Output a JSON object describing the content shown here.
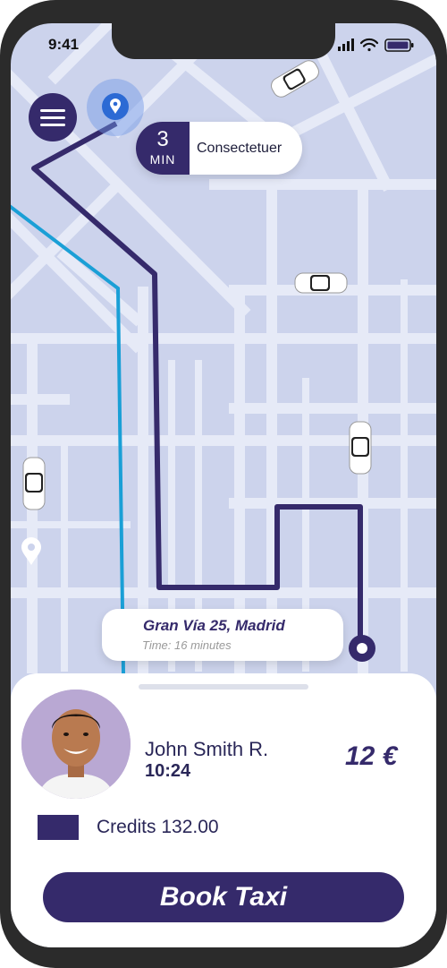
{
  "status_bar": {
    "time": "9:41"
  },
  "eta": {
    "minutes": "3",
    "unit": "MIN",
    "label": "Consectetuer"
  },
  "destination": {
    "address": "Gran Vía 25, Madrid",
    "time": "Time: 16 minutes"
  },
  "driver": {
    "name": "John Smith R.",
    "pickup_time": "10:24",
    "price": "12 €"
  },
  "credits": {
    "label": "Credits 132.00"
  },
  "actions": {
    "book_label": "Book Taxi"
  },
  "colors": {
    "primary": "#352a6b",
    "map_bg": "#ccd3ec",
    "map_road": "#e6eaf7",
    "transit_line": "#1a9fd6",
    "location_pin": "#2c6ad4"
  },
  "icons": {
    "menu": "hamburger-menu-icon",
    "location": "location-pin-icon",
    "taxi": "taxi-car-icon"
  }
}
